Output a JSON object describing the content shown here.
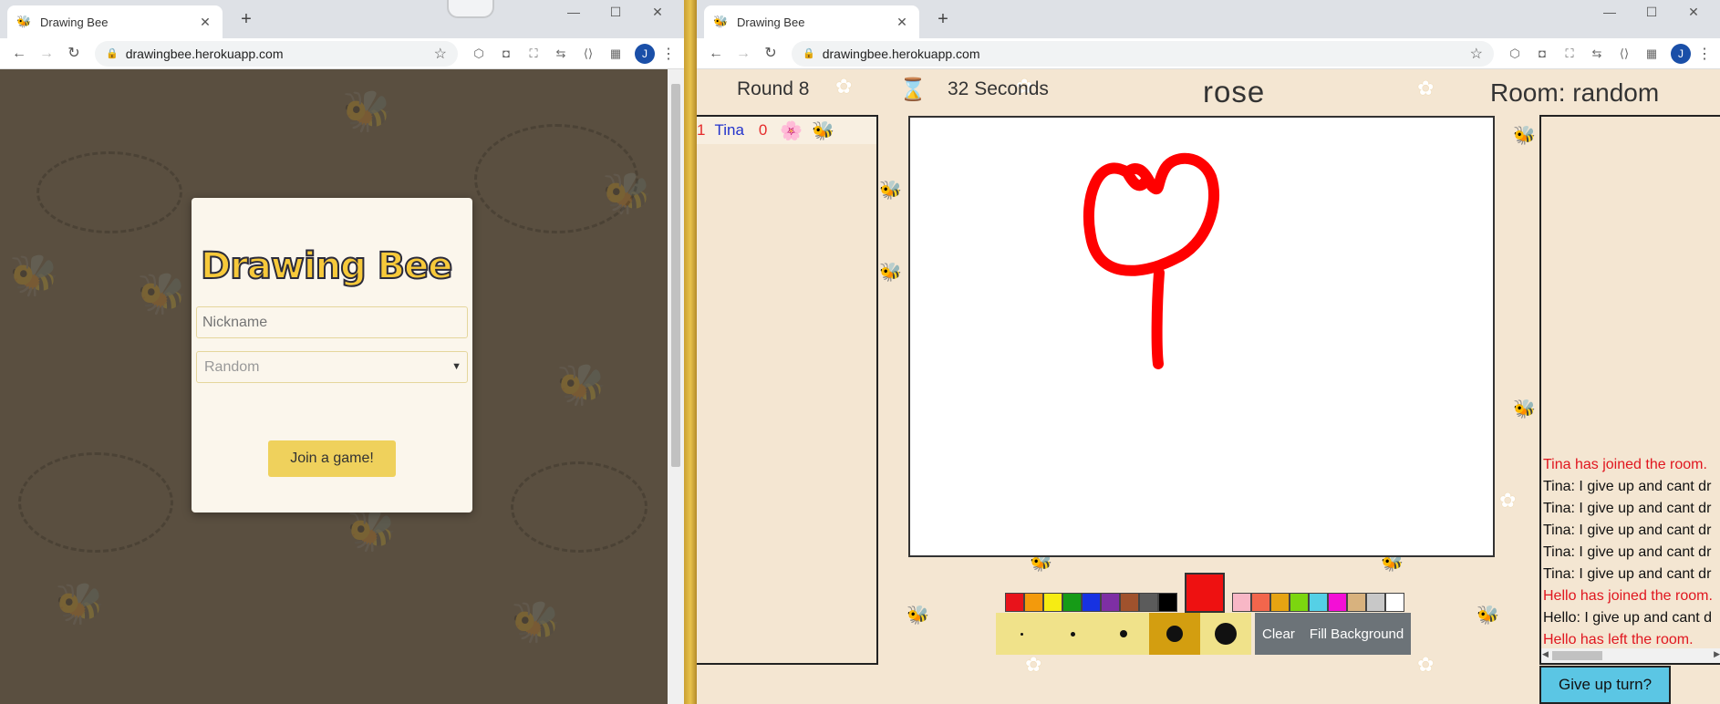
{
  "left_window": {
    "tab_title": "Drawing Bee",
    "url": "drawingbee.herokuapp.com",
    "avatar_initial": "J",
    "logo_text": "Drawing Bee",
    "nickname_placeholder": "Nickname",
    "room_select_value": "Random",
    "join_label": "Join a game!"
  },
  "right_window": {
    "tab_title": "Drawing Bee",
    "url": "drawingbee.herokuapp.com",
    "avatar_initial": "J",
    "round": "Round 8",
    "timer": "32 Seconds",
    "word": "rose",
    "room": "Room: random",
    "players": [
      {
        "rank": "1",
        "name": "Tina",
        "score": "0"
      }
    ],
    "palette_left": [
      "#e8131b",
      "#f39a0c",
      "#f6ec13",
      "#169b17",
      "#1732e2",
      "#7e2fa4",
      "#a0522d",
      "#5b5b5b",
      "#000000"
    ],
    "current_color": "#ee1111",
    "palette_right": [
      "#f8b7c6",
      "#f2664c",
      "#e6a412",
      "#7cd60f",
      "#55d0e6",
      "#f30fd6",
      "#d8b27e",
      "#c8c8c8",
      "#ffffff"
    ],
    "brush_sizes": [
      3,
      5,
      8,
      18,
      24
    ],
    "active_brush": 3,
    "clear_label": "Clear",
    "fill_label": "Fill Background",
    "chat": [
      {
        "text": "Tina has joined the room.",
        "type": "sys"
      },
      {
        "text": "Tina: I give up and cant dr",
        "type": "msg"
      },
      {
        "text": "Tina: I give up and cant dr",
        "type": "msg"
      },
      {
        "text": "Tina: I give up and cant dr",
        "type": "msg"
      },
      {
        "text": "Tina: I give up and cant dr",
        "type": "msg"
      },
      {
        "text": "Tina: I give up and cant dr",
        "type": "msg"
      },
      {
        "text": "Hello has joined the room.",
        "type": "sys"
      },
      {
        "text": "Hello: I give up and cant d",
        "type": "msg"
      },
      {
        "text": "Hello has left the room.",
        "type": "sys"
      }
    ],
    "give_up_label": "Give up turn?"
  },
  "icons": {
    "favicon": "bee-icon",
    "back": "arrow-left-icon",
    "forward": "arrow-right-icon",
    "reload": "reload-icon",
    "lock": "lock-icon",
    "bookmark": "star-icon",
    "timer": "hourglass-icon",
    "player_flower": "flower-icon",
    "player_bee": "bee-icon"
  }
}
